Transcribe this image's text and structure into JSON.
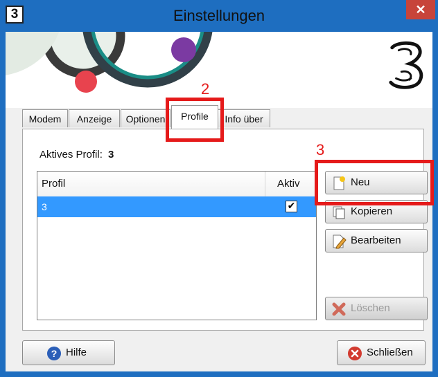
{
  "window": {
    "title": "Einstellungen",
    "app_icon": "3",
    "close_glyph": "✕"
  },
  "tabs": [
    {
      "label": "Modem",
      "active": false
    },
    {
      "label": "Anzeige",
      "active": false
    },
    {
      "label": "Optionen",
      "active": false
    },
    {
      "label": "Profile",
      "active": true
    },
    {
      "label": "Info über",
      "active": false
    }
  ],
  "profile_panel": {
    "active_profile_label": "Aktives Profil:",
    "active_profile_value": "3",
    "table": {
      "columns": [
        "Profil",
        "Aktiv"
      ],
      "rows": [
        {
          "profil": "3",
          "aktiv_mark": "✔",
          "selected": true
        }
      ]
    },
    "buttons": {
      "neu": "Neu",
      "kopieren": "Kopieren",
      "bearbeiten": "Bearbeiten",
      "loeschen": "Löschen"
    }
  },
  "footer": {
    "help_label": "Hilfe",
    "close_label": "Schließen"
  },
  "annotations": {
    "step2": "2",
    "step3": "3"
  },
  "colors": {
    "titlebar": "#1e6ec0",
    "close": "#c7443a",
    "selection": "#3399ff",
    "annotation": "#e51a1a"
  },
  "icons": [
    "app-3-icon",
    "three-logo-icon",
    "close-icon",
    "new-document-icon",
    "copy-icon",
    "edit-icon",
    "delete-x-icon",
    "help-icon",
    "close-circle-icon"
  ]
}
